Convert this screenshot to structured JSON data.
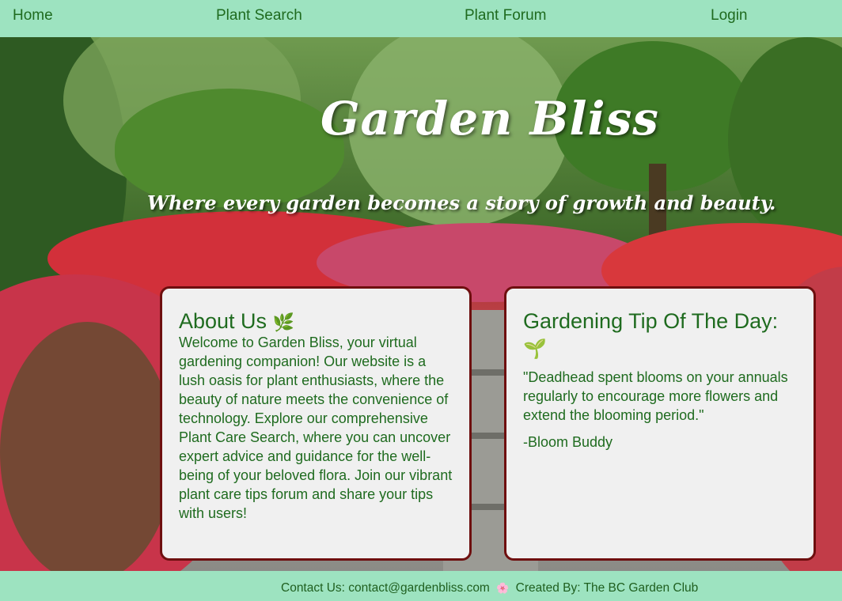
{
  "nav": {
    "items": [
      {
        "label": "Home"
      },
      {
        "label": "Plant Search"
      },
      {
        "label": "Plant Forum"
      },
      {
        "label": "Login"
      }
    ]
  },
  "hero": {
    "title": "Garden Bliss",
    "tagline": "Where every garden becomes a story of growth and beauty."
  },
  "about": {
    "heading": "About Us",
    "heading_icon": "🌿",
    "body": "Welcome to Garden Bliss, your virtual gardening companion! Our website is a lush oasis for plant enthusiasts, where the beauty of nature meets the convenience of technology. Explore our comprehensive Plant Care Search, where you can uncover expert advice and guidance for the well-being of your beloved flora. Join our vibrant plant care tips forum and share your tips with users!"
  },
  "tip": {
    "heading": "Gardening Tip Of The Day:",
    "heading_icon": "🌱",
    "quote": "\"Deadhead spent blooms on your annuals regularly to encourage more flowers and extend the blooming period.\"",
    "author": "-Bloom Buddy"
  },
  "footer": {
    "contact": "Contact Us: contact@gardenbliss.com",
    "flower_icon": "🌸",
    "credit": "Created By: The BC Garden Club"
  },
  "colors": {
    "nav_bg": "#9de3c0",
    "text_green": "#1f6b1f",
    "card_border": "#6e0f0f",
    "card_bg": "#f0f0f0"
  }
}
